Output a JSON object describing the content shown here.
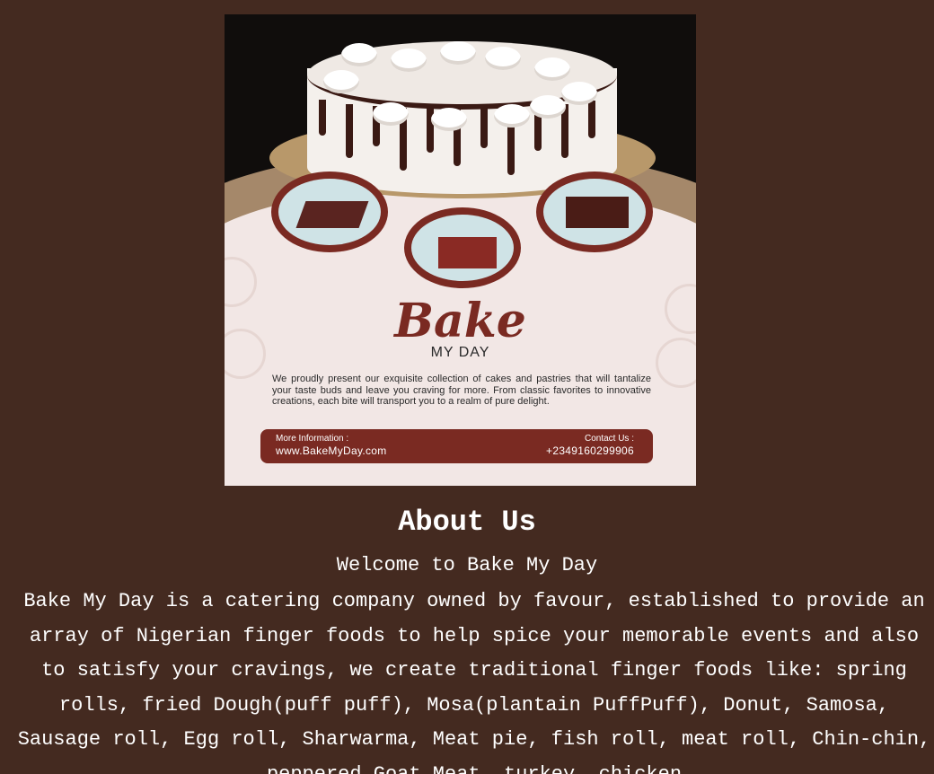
{
  "poster": {
    "brand": "Bake",
    "tagline": "MY DAY",
    "description": "We proudly present our exquisite collection of cakes and pastries that will tantalize your taste buds and leave you craving for more. From classic favorites to innovative creations, each bite will transport you to a realm of pure delight.",
    "info_label": "More Information :",
    "website": "www.BakeMyDay.com",
    "contact_label": "Contact Us :",
    "phone": "+2349160299906"
  },
  "about": {
    "title": "About Us",
    "welcome": "Welcome to Bake My Day",
    "body": "Bake My Day is a catering company owned by favour, established to provide an array of Nigerian finger foods to help spice your memorable events and also to satisfy your cravings, we create traditional finger foods like: spring rolls, fried Dough(puff puff), Mosa(plantain PuffPuff), Donut, Samosa, Sausage roll, Egg roll, Sharwarma, Meat pie, fish roll, meat roll, Chin-chin, peppered Goat Meat, turkey, chicken"
  },
  "colors": {
    "background": "#442a20",
    "text": "#ffffff",
    "poster_accent": "#7a2a22"
  }
}
